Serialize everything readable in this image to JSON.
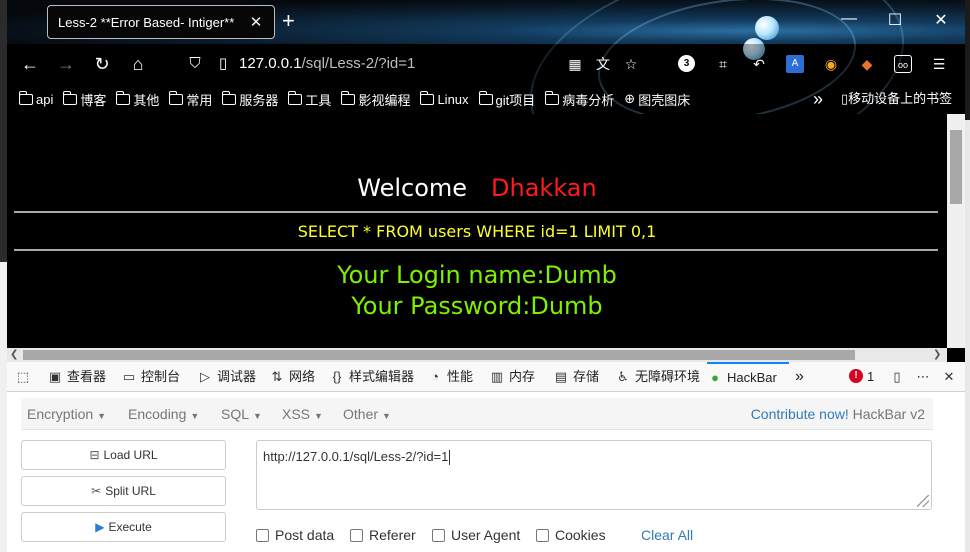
{
  "browser": {
    "tab_title": "Less-2 **Error Based- Intiger**",
    "url_host": "127.0.0.1",
    "url_path": "/sql/Less-2/?id=1",
    "extension_badge": "3"
  },
  "bookmarks": {
    "items": [
      "api",
      "博客",
      "其他",
      "常用",
      "服务器",
      "工具",
      "影视编程",
      "Linux",
      "git项目",
      "病毒分析",
      "图壳图床"
    ],
    "mobile": "移动设备上的书签"
  },
  "page": {
    "welcome": "Welcome",
    "name": "Dhakkan",
    "query": "SELECT * FROM users WHERE id=1 LIMIT 0,1",
    "login_name": "Your Login name:Dumb",
    "password": "Your Password:Dumb"
  },
  "devtools": {
    "tabs": [
      "查看器",
      "控制台",
      "调试器",
      "网络",
      "样式编辑器",
      "性能",
      "内存",
      "存储",
      "无障碍环境",
      "HackBar"
    ],
    "error_count": "1"
  },
  "hackbar": {
    "menus": [
      "Encryption",
      "Encoding",
      "SQL",
      "XSS",
      "Other"
    ],
    "contribute": "Contribute now!",
    "version": "HackBar v2",
    "load_url": "Load URL",
    "split_url": "Split URL",
    "execute": "Execute",
    "url_value": "http://127.0.0.1/sql/Less-2/?id=1",
    "options": [
      "Post data",
      "Referer",
      "User Agent",
      "Cookies"
    ],
    "clear_all": "Clear All"
  }
}
